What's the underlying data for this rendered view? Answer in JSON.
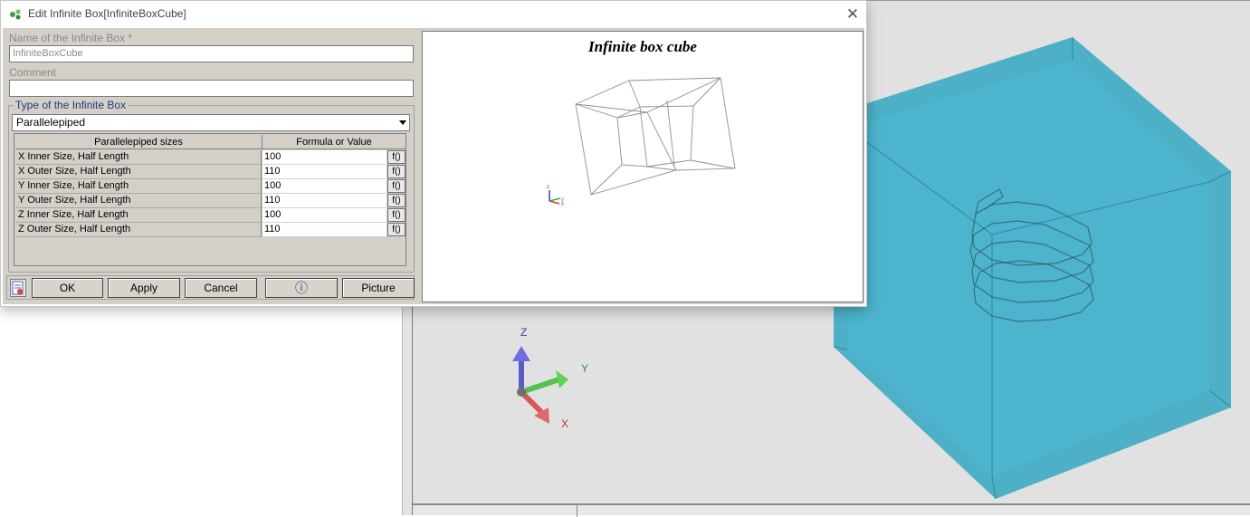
{
  "dialog": {
    "title": "Edit Infinite Box[InfiniteBoxCube]",
    "close_glyph": "✕",
    "name_label": "Name of the Infinite Box *",
    "name_value": "InfiniteBoxCube",
    "comment_label": "Comment",
    "comment_value": "",
    "type_group_label": "Type of the Infinite Box",
    "type_selected": "Parallelepiped",
    "table": {
      "headers": [
        "Parallelepiped sizes",
        "Formula or Value"
      ],
      "rows": [
        {
          "name": "X Inner Size, Half Length",
          "value": "100",
          "fx": "f()"
        },
        {
          "name": "X Outer Size, Half Length",
          "value": "110",
          "fx": "f()"
        },
        {
          "name": "Y Inner Size, Half Length",
          "value": "100",
          "fx": "f()"
        },
        {
          "name": "Y Outer Size, Half Length",
          "value": "110",
          "fx": "f()"
        },
        {
          "name": "Z Inner Size, Half Length",
          "value": "100",
          "fx": "f()"
        },
        {
          "name": "Z Outer Size, Half Length",
          "value": "110",
          "fx": "f()"
        }
      ]
    },
    "buttons": {
      "ok": "OK",
      "apply": "Apply",
      "cancel": "Cancel",
      "info_glyph": "ⓘ",
      "picture": "Picture"
    },
    "preview": {
      "title": "Infinite box cube",
      "triad": {
        "x": "x",
        "y": "y",
        "z": "z"
      }
    }
  },
  "viewport": {
    "triad": {
      "x": "X",
      "y": "Y",
      "z": "Z"
    },
    "icons": [
      "box-cube-icon",
      "coil-icon",
      "axis-triad-icon"
    ]
  },
  "colors": {
    "dialog_bg": "#d4d0c8",
    "group_label": "#1c3c80",
    "box_fill": "#3aaac4",
    "viewport_bg": "#e1e1e1"
  }
}
